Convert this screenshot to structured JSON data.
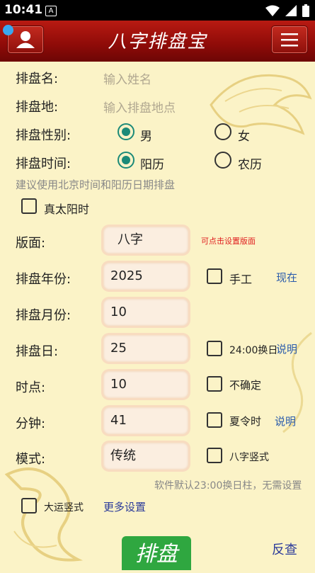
{
  "status": {
    "time": "10:41",
    "a_label": "A"
  },
  "header": {
    "title": "八字排盘宝"
  },
  "form": {
    "name_label": "排盘名:",
    "name_placeholder": "输入姓名",
    "place_label": "排盘地:",
    "place_placeholder": "输入排盘地点",
    "gender_label": "排盘性别:",
    "gender_male": "男",
    "gender_female": "女",
    "time_label": "排盘时间:",
    "cal_solar": "阳历",
    "cal_lunar": "农历",
    "suggest": "建议使用北京时间和阳历日期排盘",
    "true_solar": "真太阳时",
    "layout_label": "版面:",
    "layout_value": "八字",
    "layout_hint": "可点击设置版面",
    "year_label": "排盘年份:",
    "year_value": "2025",
    "manual": "手工",
    "now": "现在",
    "month_label": "排盘月份:",
    "month_value": "10",
    "day_label": "排盘日:",
    "day_value": "25",
    "day_change": "24:00换日",
    "explain1": "说明",
    "hour_label": "时点:",
    "hour_value": "10",
    "uncertain": "不确定",
    "minute_label": "分钟:",
    "minute_value": "41",
    "dst": "夏令时",
    "explain2": "说明",
    "mode_label": "模式:",
    "mode_value": "传统",
    "bazi_vertical": "八字竖式",
    "default_note": "软件默认23:00换日柱，无需设置",
    "dayun_vertical": "大运竖式",
    "more_settings": "更多设置"
  },
  "actions": {
    "paipan": "排盘",
    "fancha": "反查"
  },
  "colors": {
    "header": "#9e1008",
    "accent": "#1b8a78",
    "button": "#2fa740",
    "link": "#2a5bab"
  },
  "icons": [
    "user-icon",
    "menu-icon",
    "wifi-icon",
    "signal-icon",
    "battery-icon"
  ]
}
